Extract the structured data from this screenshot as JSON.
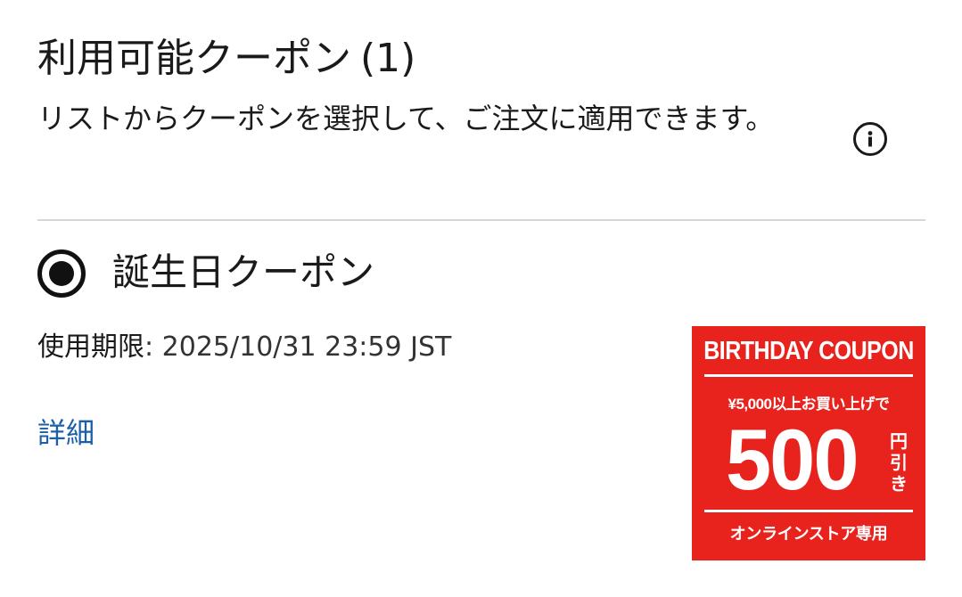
{
  "header": {
    "title": "利用可能クーポン",
    "count": "(1)",
    "description": "リストからクーポンを選択して、ご注文に適用できます。",
    "info_icon": "info-icon"
  },
  "coupons": [
    {
      "name": "誕生日クーポン",
      "selected": true,
      "expiry_label": "使用期限",
      "expiry_separator": ":",
      "expiry_value": "2025/10/31 23:59 JST",
      "details_label": "詳細",
      "image": {
        "heading": "BIRTHDAY COUPON",
        "condition": "¥5,000以上お買い上げで",
        "amount": "500",
        "unit": "円引き",
        "footer": "オンラインストア専用",
        "background_color": "#e8231d",
        "text_color": "#ffffff"
      }
    }
  ],
  "colors": {
    "link": "#1a5fa8",
    "divider": "#d6d6d6",
    "text": "#1a1a1a"
  }
}
